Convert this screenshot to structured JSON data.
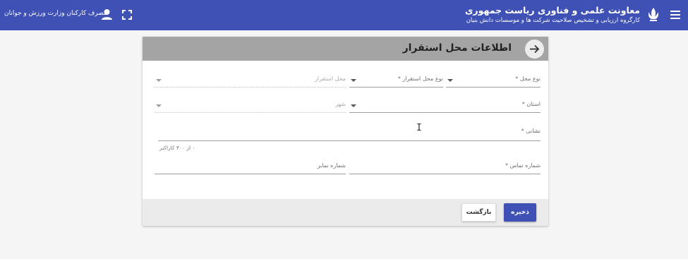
{
  "header": {
    "brand_title": "معاونت علمی و فناوری ریاست جمهوری",
    "brand_subtitle": "کارگروه ارزیابی و تشخیص صلاحیت شرکت ها و موسسات دانش بنیان",
    "user_name": "مصرف کارکنان وزارت ورزش و جوانان",
    "icons": [
      "menu-icon",
      "emblem-icon",
      "user-icon",
      "fullscreen-icon"
    ]
  },
  "card": {
    "title": "اطلاعات محل استقرار",
    "fields": {
      "location_type": {
        "label": "نوع محل *",
        "value": ""
      },
      "settlement_type": {
        "label": "نوع محل استقرار *",
        "value": ""
      },
      "settlement_place": {
        "label": "محل استقرار",
        "value": ""
      },
      "province": {
        "label": "استان *",
        "value": ""
      },
      "city": {
        "label": "شهر",
        "value": ""
      },
      "address": {
        "label": "نشانی *",
        "value": "",
        "hint": "۰ از ۳۰۰ کاراکتر"
      },
      "phone": {
        "label": "شماره تماس *",
        "value": ""
      },
      "fax": {
        "label": "شماره نمابر",
        "value": ""
      }
    },
    "buttons": {
      "save": "ذخیره",
      "back": "بازگشت"
    }
  },
  "colors": {
    "primary": "#3f51b5",
    "card_header": "#a4a4a4",
    "background": "#f5f5f5"
  }
}
